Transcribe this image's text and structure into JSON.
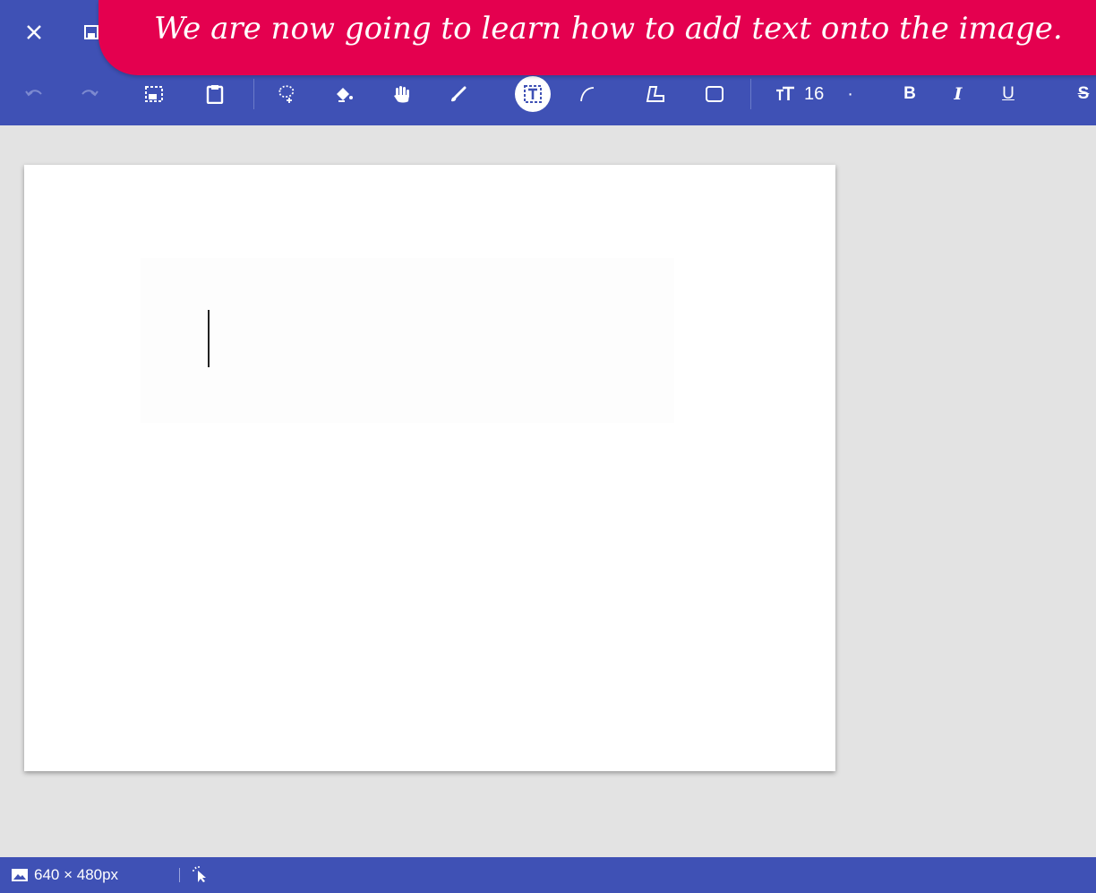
{
  "banner": {
    "text": "We are now going to learn how to add text onto the image."
  },
  "titlebar": {
    "close_icon": "close-icon",
    "save_icon": "save-icon"
  },
  "toolbar": {
    "tools": [
      {
        "name": "undo-icon"
      },
      {
        "name": "redo-icon"
      },
      {
        "name": "save-image-icon"
      },
      {
        "name": "paste-icon"
      },
      {
        "name": "lasso-select-icon"
      },
      {
        "name": "fill-bucket-icon"
      },
      {
        "name": "hand-pan-icon"
      },
      {
        "name": "brush-icon"
      },
      {
        "name": "text-tool-icon",
        "active": true
      },
      {
        "name": "curve-icon"
      },
      {
        "name": "polygon-icon"
      },
      {
        "name": "rectangle-icon"
      }
    ],
    "font_size_icon": "font-size-icon",
    "font_size": "16",
    "font_size_step": "·",
    "bold_label": "B",
    "italic_label": "I",
    "underline_label": "U",
    "strike_label": "S"
  },
  "status": {
    "canvas_size": "640 × 480px",
    "image_icon": "image-icon",
    "cursor_icon": "cursor-icon"
  },
  "colors": {
    "toolbar": "#3f51b5",
    "banner": "#e4004f",
    "workspace": "#e3e3e3"
  }
}
